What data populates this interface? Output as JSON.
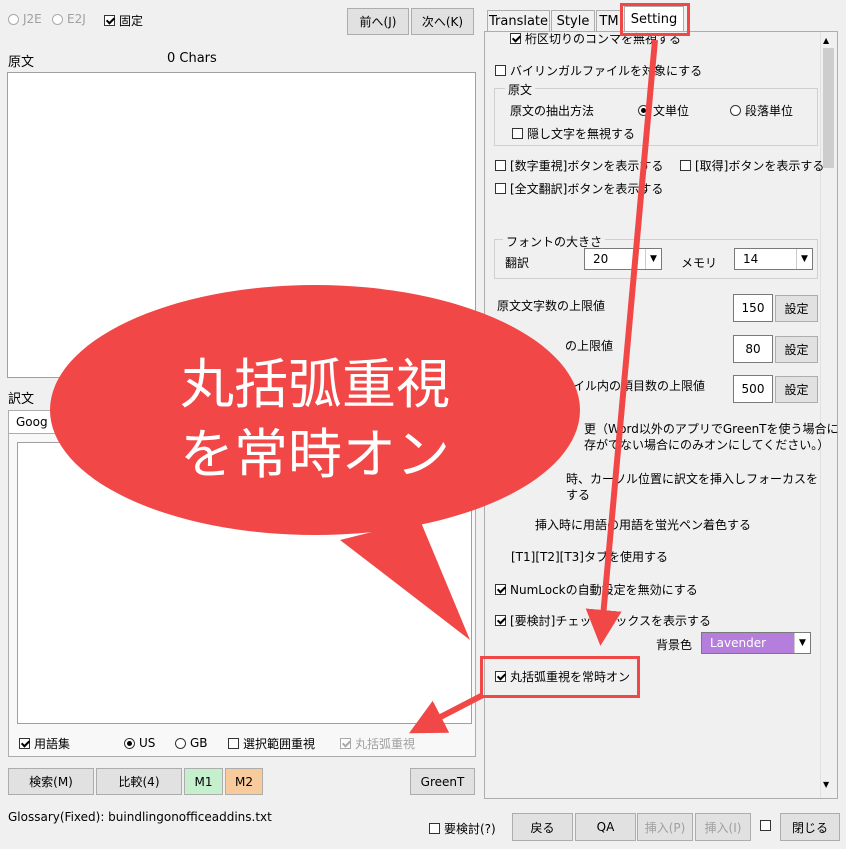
{
  "left": {
    "mode_j2e": "J2E",
    "mode_e2j": "E2J",
    "fixed_label": "固定",
    "prev_button": "前へ(J)",
    "next_button": "次へ(K)",
    "source_label": "原文",
    "char_count": "0 Chars",
    "translation_label": "訳文",
    "engine_tab": "Goog",
    "glossary_label": "用語集",
    "us_label": "US",
    "gb_label": "GB",
    "selection_label": "選択範囲重視",
    "paren_label": "丸括弧重視",
    "search_button": "検索(M)",
    "compare_button": "比較(4)",
    "m1_button": "M1",
    "m2_button": "M2",
    "greent_button": "GreenT"
  },
  "tabs": [
    "Translate",
    "Style",
    "TM",
    "Setting"
  ],
  "settings": {
    "item_comma": "桁区切りのコンマを無視する",
    "item_bilingual": "バイリンガルファイルを対象にする",
    "group_source": "原文",
    "extract_label": "原文の抽出方法",
    "sentence_unit": "文単位",
    "paragraph_unit": "段落単位",
    "ignore_hidden": "隠し文字を無視する",
    "show_number_btn": "[数字重視]ボタンを表示する",
    "show_get_btn": "[取得]ボタンを表示する",
    "show_full_btn": "[全文翻訳]ボタンを表示する",
    "font_group": "フォントの大きさ",
    "font_trans_label": "翻訳",
    "font_trans_value": "20",
    "font_memo_label": "メモリ",
    "font_memo_value": "14",
    "limit1_label": "原文文字数の上限値",
    "limit1_value": "150",
    "limit2_label": "の上限値",
    "limit2_value": "80",
    "limit3_label": "イル内の項目数の上限値",
    "limit3_value": "500",
    "set_button": "設定",
    "note1": "更（Word以外のアプリでGreenTを使う場合に",
    "note2": "存がでない場合にのみオンにしてください。）",
    "insert1": "時、カーソル位置に訳文を挿入しフォーカスを",
    "insert2": "する",
    "highlight": "挿入時に用語の用語を蛍光ペン着色する",
    "tabs_use": "[T1][T2][T3]タブを使用する",
    "numlock": "NumLockの自動設定を無効にする",
    "review_box": "[要検討]チェックボックスを表示する",
    "bg_label": "背景色",
    "bg_value": "Lavender",
    "paren_always": "丸括弧重視を常時オン"
  },
  "bottom": {
    "glossary_file": "Glossary(Fixed): buindlingonofficeaddins.txt",
    "review_label": "要検討(?)",
    "back_button": "戻る",
    "qa_button": "QA",
    "insert_p_button": "挿入(P)",
    "insert_i_button": "挿入(I)",
    "close_button": "閉じる"
  },
  "callout": {
    "line1": "丸括弧重視",
    "line2": "を常時オン"
  },
  "colors": {
    "callout": "#f14747",
    "m1": "#c6efce",
    "m2": "#f8cb9c",
    "lavender": "#b57edc"
  }
}
